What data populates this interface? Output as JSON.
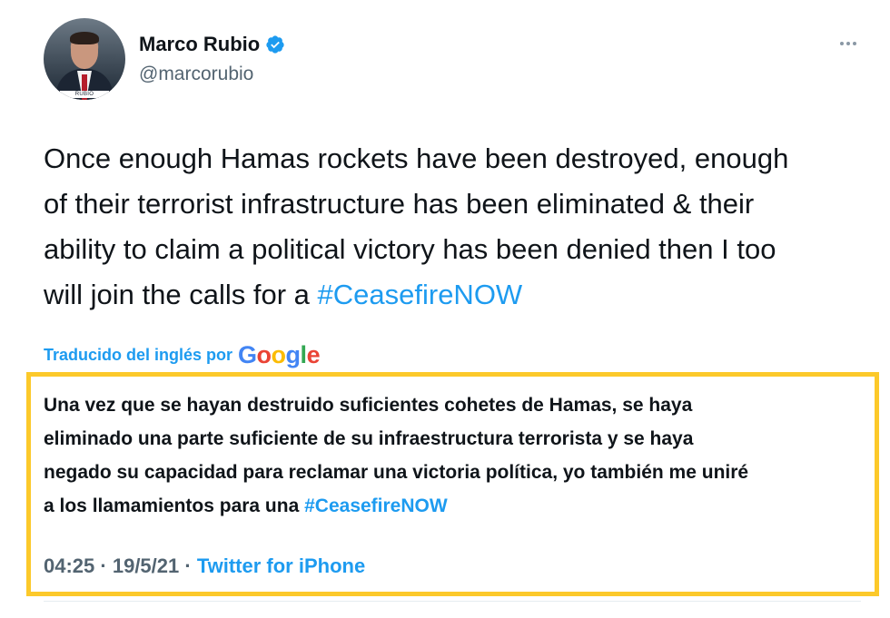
{
  "user": {
    "display_name": "Marco Rubio",
    "handle": "@marcorubio",
    "verified": true,
    "avatar_caption": "RUBIO"
  },
  "tweet": {
    "text_lines": [
      "Once enough Hamas rockets have been destroyed, enough",
      "of their terrorist infrastructure has been eliminated & their",
      "ability to claim a political victory has been denied then I too",
      "will join the calls for a "
    ],
    "hashtag": "#CeasefireNOW"
  },
  "translation": {
    "attribution_label": "Traducido del inglés por",
    "provider": "Google",
    "text_lines": [
      "Una vez que se hayan destruido suficientes cohetes de Hamas, se haya",
      "eliminado una parte suficiente de su infraestructura terrorista y se haya",
      "negado su capacidad para reclamar una victoria política, yo también me uniré",
      "a los llamamientos para una "
    ],
    "hashtag": "#CeasefireNOW"
  },
  "meta": {
    "time": "04:25",
    "separator": " · ",
    "date": "19/5/21",
    "source": "Twitter for iPhone"
  },
  "colors": {
    "link": "#1d9bf0",
    "highlight_border": "#fcc92a",
    "secondary_text": "#536471"
  },
  "icons": {
    "more": "more-options-icon",
    "verified": "verified-badge-icon"
  }
}
